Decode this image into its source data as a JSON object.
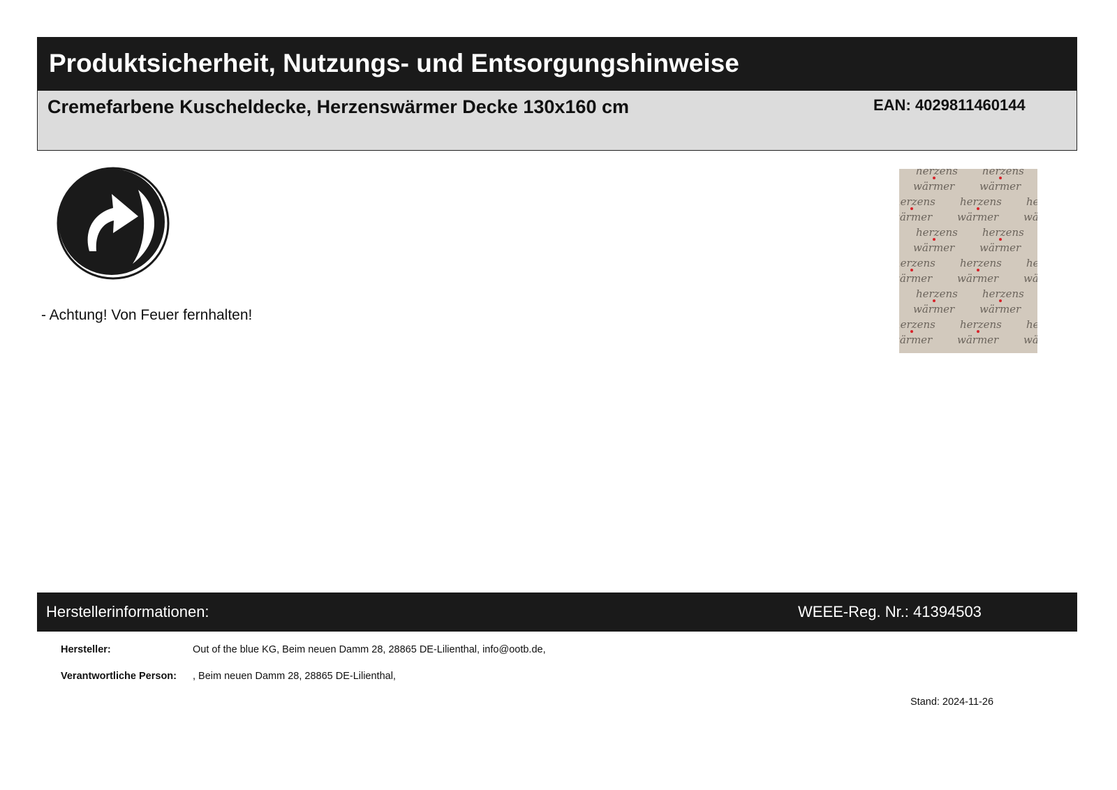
{
  "header": {
    "title": "Produktsicherheit, Nutzungs- und Entsorgungshinweise",
    "product_name": "Cremefarbene Kuscheldecke, Herzenswärmer Decke 130x160 cm",
    "ean": "EAN: 4029811460144"
  },
  "body": {
    "recycling_logo_icon": "green-dot-recycling-icon",
    "warning": "- Achtung! Von Feuer fernhalten!",
    "product_image": {
      "icon": "blanket-product-photo",
      "pattern_words": [
        "herzens",
        "wärmer"
      ],
      "background_color": "#d2c9bd",
      "text_color": "#6b645c",
      "heart_color": "#d8232a"
    }
  },
  "manufacturer": {
    "heading": "Herstellerinformationen:",
    "weee": "WEEE-Reg. Nr.: 41394503",
    "rows": [
      {
        "label": "Hersteller:",
        "value": "Out of the blue KG, Beim neuen Damm 28, 28865 DE-Lilienthal, info@ootb.de,"
      },
      {
        "label": "Verantwortliche Person:",
        "value": ", Beim neuen Damm 28, 28865 DE-Lilienthal,"
      }
    ]
  },
  "footer": {
    "stand_label": "Stand:",
    "stand_date": "2024-11-26"
  },
  "colors": {
    "bar_background": "#1a1a1a",
    "product_box_background": "#dcdcdc"
  }
}
